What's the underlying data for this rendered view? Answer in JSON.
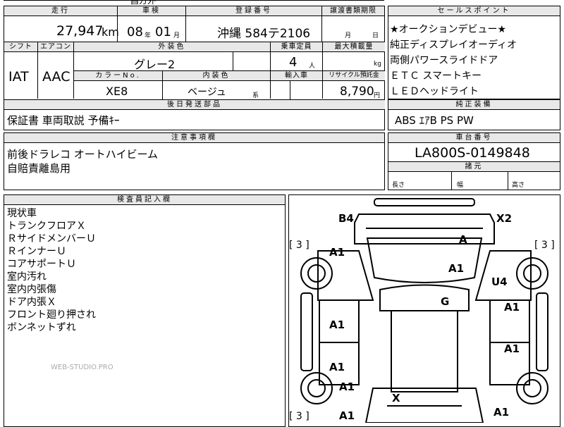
{
  "top_strip": {
    "partial_text": "昌方外"
  },
  "grid": {
    "headers": {
      "mileage": "走行",
      "inspection": "車検",
      "registration": "登録番号",
      "transfer_deadline": "譲渡書類期限",
      "shift": "シフト",
      "aircon": "エアコン",
      "exterior_color": "外装色",
      "capacity": "乗車定員",
      "max_load": "最大積載量",
      "color_no": "カラーNo.",
      "interior_color": "内装色",
      "imported": "輸入車",
      "recycle": "リサイクル預託金",
      "rear_parts": "後日発送部品",
      "notes": "注意事項欄",
      "inspector": "検査員記入欄"
    },
    "mileage_value": "27,947",
    "mileage_unit": "km",
    "inspection_year": "08",
    "inspection_year_unit": "年",
    "inspection_month": "01",
    "inspection_month_unit": "月",
    "registration_number": "沖縄 584テ2106",
    "transfer_month_unit": "月",
    "transfer_day_unit": "日",
    "shift_value": "IAT",
    "aircon_value": "AAC",
    "exterior_color_value": "グレー2",
    "capacity_value": "4",
    "capacity_unit": "人",
    "max_load_unit": "kg",
    "color_no_value": "XE8",
    "interior_color_value": "ベージュ",
    "interior_color_suffix": "系",
    "recycle_value": "8,790",
    "recycle_unit": "円",
    "rear_parts_value": "保証書 車両取説 予備ｷｰ",
    "notes_lines": [
      "前後ドラレコ オートハイビーム",
      "自賠責離島用"
    ]
  },
  "selling_points": {
    "header": "セールスポイント",
    "lines": [
      "★オークションデビュー★",
      "純正ディスプレイオーディオ",
      "両側パワースライドドア",
      "ＥＴＣ スマートキー",
      "ＬＥＤヘッドライト"
    ]
  },
  "genuine_equipment": {
    "header": "純正装備",
    "value": "ABS ｴｱB PS PW"
  },
  "chassis": {
    "header": "車台番号",
    "value": "LA800S-0149848",
    "dims_header": "諸元",
    "length_label": "長さ",
    "width_label": "幅",
    "height_label": "高さ"
  },
  "inspector_notes": [
    "現状車",
    "トランクフロアＸ",
    "ＲサイドメンバーＵ",
    "ＲインナーＵ",
    "コアサポートＵ",
    "室内汚れ",
    "室内内張傷",
    "ドア内張Ｘ",
    "フロント廻り押され",
    "ボンネットずれ"
  ],
  "watermark": "WEB-STUDIO.PRO",
  "diagram": {
    "tire_markers": [
      "[ 3 ]",
      "[ 3 ]",
      "[ 3 ]"
    ],
    "damage_codes": [
      {
        "code": "B4"
      },
      {
        "code": "X2"
      },
      {
        "code": "A"
      },
      {
        "code": "A1"
      },
      {
        "code": "A1"
      },
      {
        "code": "U4"
      },
      {
        "code": "G"
      },
      {
        "code": "A1"
      },
      {
        "code": "A1"
      },
      {
        "code": "A1"
      },
      {
        "code": "A1"
      },
      {
        "code": "A1"
      },
      {
        "code": "A1"
      },
      {
        "code": "X"
      },
      {
        "code": "A1"
      }
    ]
  }
}
